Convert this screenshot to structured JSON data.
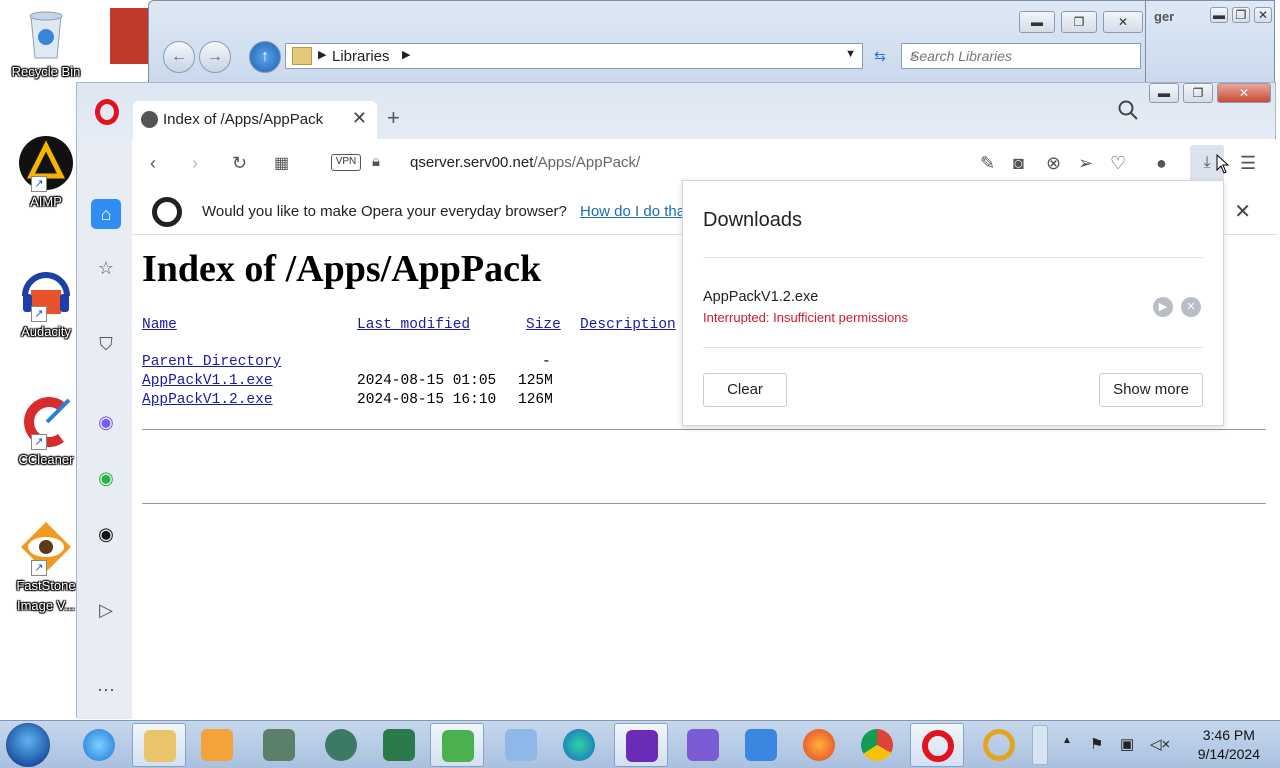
{
  "desktop": {
    "icons": [
      {
        "label": "Recycle Bin"
      },
      {
        "label": "AIMP"
      },
      {
        "label": "Audacity"
      },
      {
        "label": "CCleaner"
      },
      {
        "label": "FastStone Image V..."
      }
    ]
  },
  "explorer": {
    "path": "Libraries",
    "search_placeholder": "Search Libraries",
    "second_window_title": "ger"
  },
  "opera": {
    "tab": {
      "title": "Index of /Apps/AppPack"
    },
    "toolbar": {
      "vpn_label": "VPN",
      "url_host": "qserver.serv00.net",
      "url_path": "/Apps/AppPack/"
    },
    "infobar": {
      "text": "Would you like to make Opera your everyday browser?",
      "link": "How do I do tha"
    },
    "page": {
      "title": "Index of /Apps/AppPack",
      "headers": {
        "name": "Name",
        "modified": "Last modified",
        "size": "Size",
        "description": "Description"
      },
      "rows": [
        {
          "name": "Parent Directory",
          "modified": "",
          "size": "-"
        },
        {
          "name": "AppPackV1.1.exe",
          "modified": "2024-08-15 01:05",
          "size": "125M"
        },
        {
          "name": "AppPackV1.2.exe",
          "modified": "2024-08-15 16:10",
          "size": "126M"
        }
      ]
    },
    "downloads": {
      "title": "Downloads",
      "file_name": "AppPackV1.2.exe",
      "status": "Interrupted: Insufficient permissions",
      "clear_label": "Clear",
      "show_more_label": "Show more"
    }
  },
  "taskbar": {
    "time": "3:46 PM",
    "date": "9/14/2024"
  },
  "colors": {
    "error_red": "#d3182b",
    "link_blue": "#1a6ab5",
    "opera_red": "#e0141e"
  }
}
